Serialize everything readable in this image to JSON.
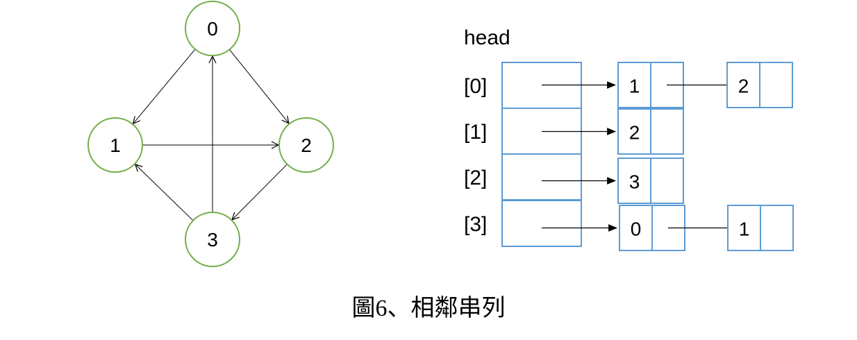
{
  "graph": {
    "nodes": [
      {
        "id": "0",
        "label": "0"
      },
      {
        "id": "1",
        "label": "1"
      },
      {
        "id": "2",
        "label": "2"
      },
      {
        "id": "3",
        "label": "3"
      }
    ],
    "edges": [
      {
        "from": "0",
        "to": "1"
      },
      {
        "from": "0",
        "to": "2"
      },
      {
        "from": "1",
        "to": "2"
      },
      {
        "from": "2",
        "to": "3"
      },
      {
        "from": "3",
        "to": "0"
      },
      {
        "from": "3",
        "to": "1"
      }
    ]
  },
  "adjacency_list": {
    "head_label": "head",
    "rows": [
      {
        "index_label": "[0]",
        "items": [
          "1",
          "2"
        ]
      },
      {
        "index_label": "[1]",
        "items": [
          "2"
        ]
      },
      {
        "index_label": "[2]",
        "items": [
          "3"
        ]
      },
      {
        "index_label": "[3]",
        "items": [
          "0",
          "1"
        ]
      }
    ]
  },
  "caption": "圖6、相鄰串列"
}
